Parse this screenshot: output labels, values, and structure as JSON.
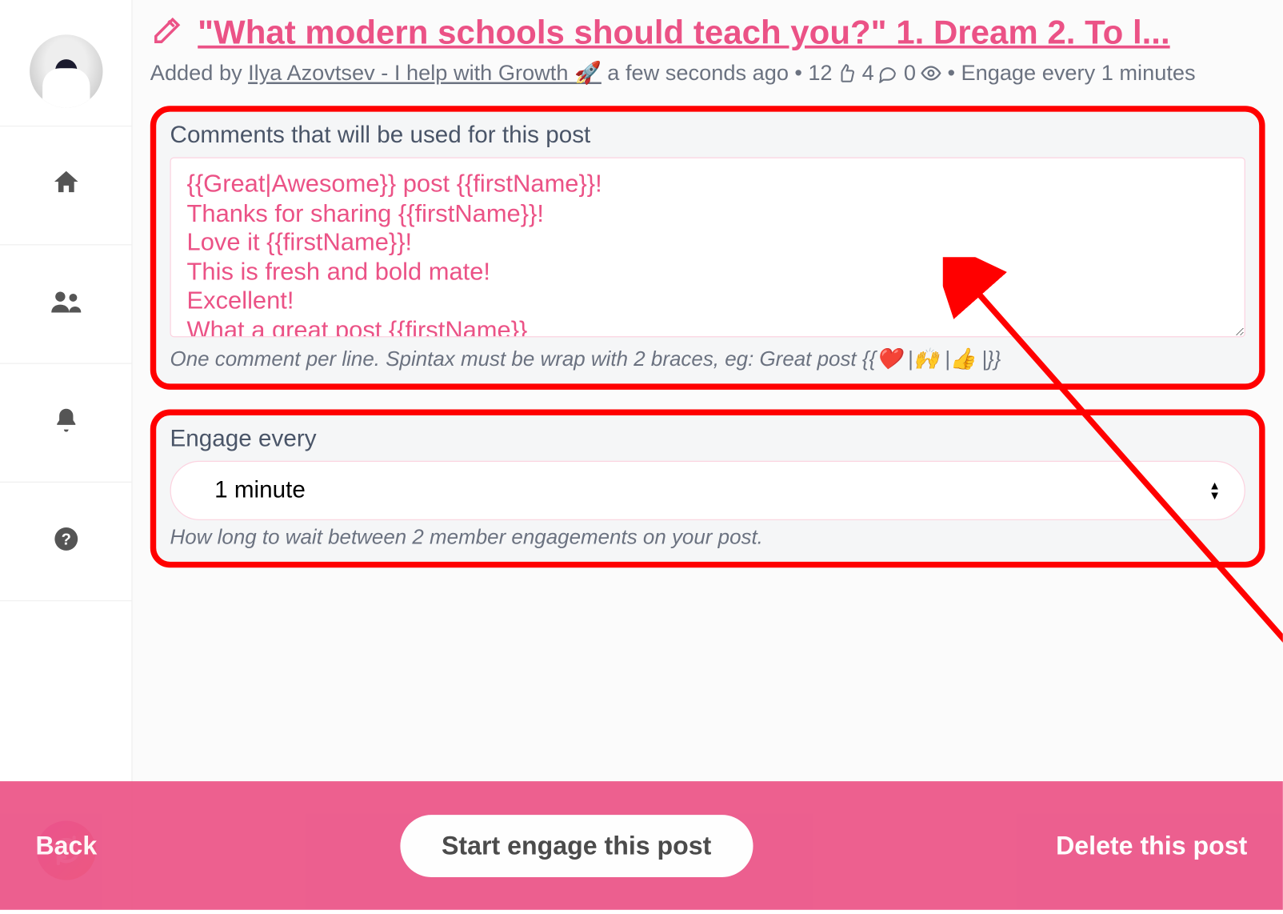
{
  "title": "\"What modern schools should teach you?\" 1. Dream 2. To l...",
  "meta": {
    "added_by_prefix": "Added by",
    "author": "Ilya Azovtsev - I help with Growth 🚀",
    "time_ago": "a few seconds ago",
    "likes": "12",
    "comments": "4",
    "views": "0",
    "engage_suffix": "Engage every 1 minutes"
  },
  "comments_section": {
    "label": "Comments that will be used for this post",
    "value": "{{Great|Awesome}} post {{firstName}}!\nThanks for sharing {{firstName}}!\nLove it {{firstName}}!\nThis is fresh and bold mate!\nExcellent!\nWhat a great post {{firstName}}",
    "hint": "One comment per line. Spintax must be wrap with 2 braces, eg: Great post {{❤️ |🙌 |👍 |}}"
  },
  "engage_section": {
    "label": "Engage every",
    "value": "1 minute",
    "hint": "How long to wait between 2 member engagements on your post."
  },
  "footer": {
    "back": "Back",
    "start": "Start engage this post",
    "delete": "Delete this post"
  },
  "sidebar": {
    "items": [
      "avatar",
      "home",
      "users",
      "bell",
      "help",
      "logo"
    ]
  }
}
